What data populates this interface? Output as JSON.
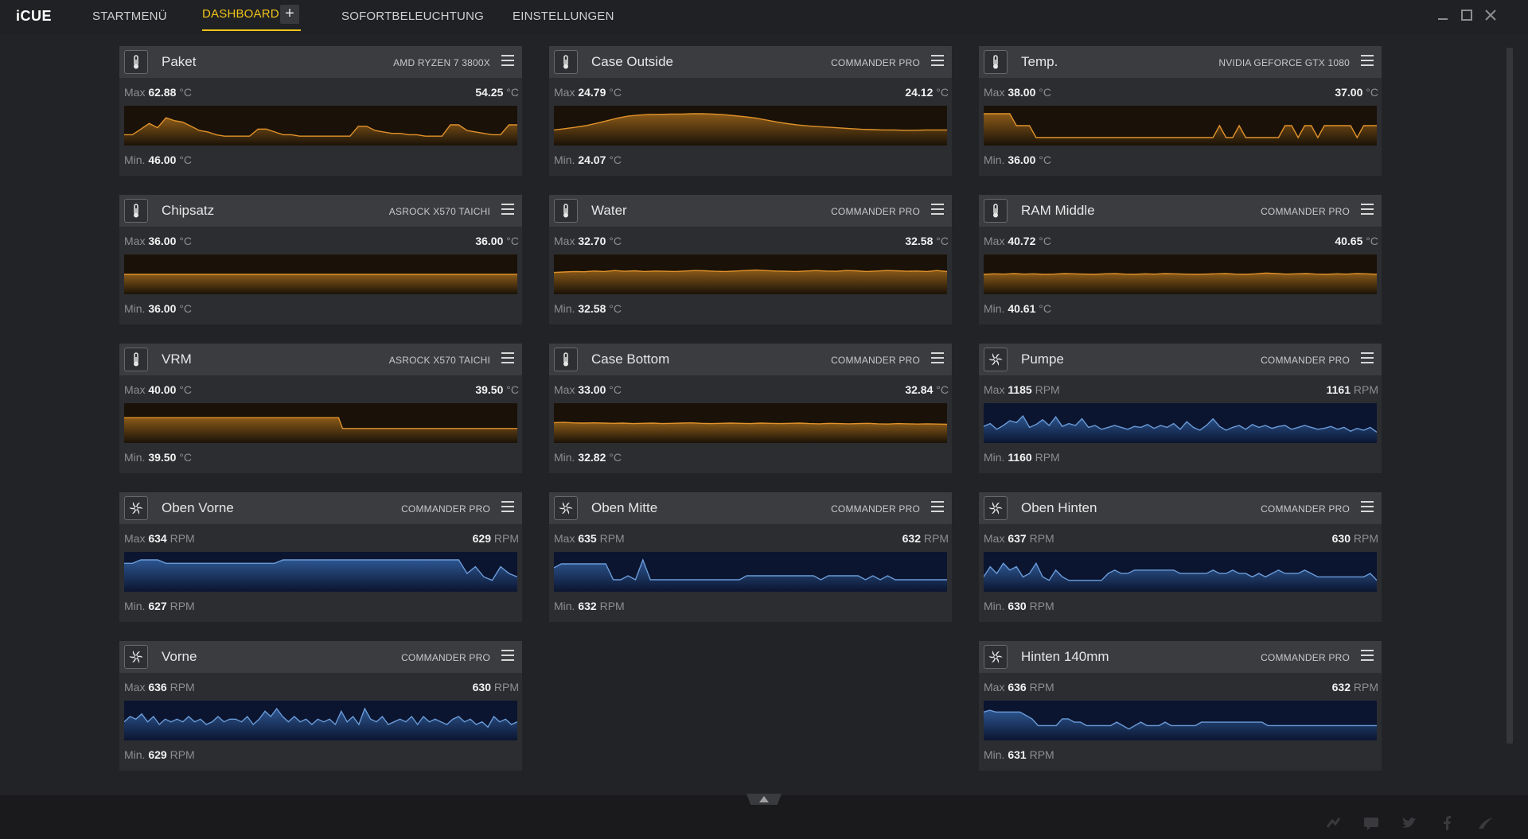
{
  "app": {
    "logo": "iCUE"
  },
  "nav": {
    "items": [
      {
        "label": "STARTMENÜ",
        "active": false
      },
      {
        "label": "DASHBOARD",
        "active": true
      },
      {
        "label": "SOFORTBELEUCHTUNG",
        "active": false
      },
      {
        "label": "EINSTELLUNGEN",
        "active": false
      }
    ],
    "add_label": "+"
  },
  "colors": {
    "accent": "#f0c419",
    "temp_line": "#e0912a",
    "temp_fill_top": "#8a5a18",
    "temp_fill_bottom": "#1a1208",
    "fan_line": "#6a9bd8",
    "fan_fill_top": "#2d5690",
    "fan_fill_bottom": "#0b1530"
  },
  "widgets": [
    {
      "id": "paket",
      "kind": "temp",
      "icon": "thermometer-icon",
      "title": "Paket",
      "device": "AMD RYZEN 7 3800X",
      "max_label": "Max",
      "max": "62.88",
      "current": "54.25",
      "min_label": "Min.",
      "min": "46.00",
      "unit": "°C",
      "range": [
        46.0,
        62.88
      ],
      "series": [
        48,
        48,
        52,
        56,
        53,
        60,
        58,
        57,
        54,
        51,
        50,
        48,
        47,
        47,
        47,
        47,
        52,
        52,
        50,
        48,
        48,
        47,
        47,
        47,
        47,
        47,
        47,
        47,
        54,
        54,
        51,
        50,
        49,
        49,
        48,
        48,
        47,
        47,
        47,
        55,
        55,
        51,
        50,
        49,
        48,
        48,
        55,
        55
      ]
    },
    {
      "id": "case-outside",
      "kind": "temp",
      "icon": "thermometer-icon",
      "title": "Case Outside",
      "device": "COMMANDER PRO",
      "max_label": "Max",
      "max": "24.79",
      "current": "24.12",
      "min_label": "Min.",
      "min": "24.07",
      "unit": "°C",
      "range": [
        24.07,
        24.79
      ],
      "series": [
        24.3,
        24.34,
        24.38,
        24.43,
        24.5,
        24.58,
        24.66,
        24.72,
        24.75,
        24.77,
        24.77,
        24.78,
        24.78,
        24.79,
        24.79,
        24.78,
        24.76,
        24.73,
        24.7,
        24.66,
        24.6,
        24.54,
        24.49,
        24.45,
        24.42,
        24.4,
        24.38,
        24.36,
        24.34,
        24.32,
        24.31,
        24.3,
        24.3,
        24.29,
        24.29,
        24.3,
        24.3,
        24.3
      ]
    },
    {
      "id": "temp-gpu",
      "kind": "temp",
      "icon": "thermometer-icon",
      "title": "Temp.",
      "device": "NVIDIA GEFORCE GTX 1080",
      "max_label": "Max",
      "max": "38.00",
      "current": "37.00",
      "min_label": "Min.",
      "min": "36.00",
      "unit": "°C",
      "range": [
        36.0,
        38.0
      ],
      "series": [
        38,
        38,
        38,
        38,
        38,
        37,
        37,
        37,
        36,
        36,
        36,
        36,
        36,
        36,
        36,
        36,
        36,
        36,
        36,
        36,
        36,
        36,
        36,
        36,
        36,
        36,
        36,
        36,
        36,
        36,
        36,
        36,
        36,
        36,
        36,
        36,
        37,
        36,
        36,
        37,
        36,
        36,
        36,
        36,
        36,
        36,
        37,
        37,
        36,
        37,
        37,
        36,
        37,
        37,
        37,
        37,
        37,
        36,
        37,
        37,
        37
      ]
    },
    {
      "id": "chipsatz",
      "kind": "temp",
      "icon": "thermometer-icon",
      "title": "Chipsatz",
      "device": "ASROCK X570 TAICHI",
      "max_label": "Max",
      "max": "36.00",
      "current": "36.00",
      "min_label": "Min.",
      "min": "36.00",
      "unit": "°C",
      "range": [
        35.0,
        37.0
      ],
      "series": [
        36,
        36,
        36,
        36,
        36,
        36,
        36,
        36,
        36,
        36
      ]
    },
    {
      "id": "water",
      "kind": "temp",
      "icon": "thermometer-icon",
      "title": "Water",
      "device": "COMMANDER PRO",
      "max_label": "Max",
      "max": "32.70",
      "current": "32.58",
      "min_label": "Min.",
      "min": "32.58",
      "unit": "°C",
      "range": [
        32.0,
        33.0
      ],
      "series": [
        32.58,
        32.6,
        32.62,
        32.61,
        32.64,
        32.62,
        32.66,
        32.63,
        32.65,
        32.62,
        32.64,
        32.63,
        32.62,
        32.64,
        32.66,
        32.65,
        32.63,
        32.62,
        32.64,
        32.66,
        32.68,
        32.66,
        32.64,
        32.63,
        32.62,
        32.64,
        32.66,
        32.64,
        32.63,
        32.66,
        32.65,
        32.62,
        32.64,
        32.66,
        32.65,
        32.63,
        32.64,
        32.62,
        32.66,
        32.62
      ]
    },
    {
      "id": "ram-middle",
      "kind": "temp",
      "icon": "thermometer-icon",
      "title": "RAM Middle",
      "device": "COMMANDER PRO",
      "max_label": "Max",
      "max": "40.72",
      "current": "40.65",
      "min_label": "Min.",
      "min": "40.61",
      "unit": "°C",
      "range": [
        40.2,
        41.1
      ],
      "series": [
        40.65,
        40.67,
        40.66,
        40.68,
        40.66,
        40.67,
        40.65,
        40.66,
        40.68,
        40.67,
        40.66,
        40.65,
        40.67,
        40.68,
        40.66,
        40.65,
        40.67,
        40.66,
        40.68,
        40.67,
        40.66,
        40.65,
        40.66,
        40.67,
        40.68,
        40.66,
        40.65,
        40.67,
        40.7,
        40.68,
        40.66,
        40.67,
        40.68,
        40.66,
        40.65,
        40.67,
        40.66,
        40.68,
        40.67,
        40.65
      ]
    },
    {
      "id": "vrm",
      "kind": "temp",
      "icon": "thermometer-icon",
      "title": "VRM",
      "device": "ASROCK X570 TAICHI",
      "max_label": "Max",
      "max": "40.00",
      "current": "39.50",
      "min_label": "Min.",
      "min": "39.50",
      "unit": "°C",
      "range": [
        39.2,
        40.3
      ],
      "series": [
        40,
        40,
        40,
        40,
        40,
        40,
        40,
        40,
        40,
        40,
        40,
        40,
        40,
        40,
        40,
        40,
        40,
        40,
        40,
        40,
        40,
        40,
        40,
        40,
        40,
        40,
        40,
        40,
        40,
        40,
        40,
        40,
        40,
        40,
        40,
        40,
        40,
        40,
        40,
        40,
        40,
        40,
        40,
        40,
        40,
        40,
        40,
        40,
        40,
        40,
        40,
        40,
        40,
        40,
        40,
        39.5,
        39.5,
        39.5,
        39.5,
        39.5,
        39.5,
        39.5,
        39.5,
        39.5,
        39.5,
        39.5,
        39.5,
        39.5,
        39.5,
        39.5,
        39.5,
        39.5,
        39.5,
        39.5,
        39.5,
        39.5,
        39.5,
        39.5,
        39.5,
        39.5,
        39.5,
        39.5,
        39.5,
        39.5,
        39.5,
        39.5,
        39.5,
        39.5,
        39.5,
        39.5,
        39.5,
        39.5,
        39.5,
        39.5,
        39.5,
        39.5,
        39.5,
        39.5,
        39.5,
        39.5
      ]
    },
    {
      "id": "case-bottom",
      "kind": "temp",
      "icon": "thermometer-icon",
      "title": "Case Bottom",
      "device": "COMMANDER PRO",
      "max_label": "Max",
      "max": "33.00",
      "current": "32.84",
      "min_label": "Min.",
      "min": "32.82",
      "unit": "°C",
      "range": [
        32.4,
        33.4
      ],
      "series": [
        32.92,
        32.93,
        32.91,
        32.9,
        32.91,
        32.9,
        32.89,
        32.9,
        32.88,
        32.89,
        32.9,
        32.88,
        32.89,
        32.9,
        32.91,
        32.89,
        32.88,
        32.89,
        32.9,
        32.89,
        32.88,
        32.9,
        32.89,
        32.88,
        32.89,
        32.9,
        32.88,
        32.87,
        32.89,
        32.88,
        32.87,
        32.88,
        32.89,
        32.87,
        32.86,
        32.88,
        32.87,
        32.86,
        32.87,
        32.86,
        32.85
      ]
    },
    {
      "id": "pumpe",
      "kind": "fan",
      "icon": "fan-icon",
      "title": "Pumpe",
      "device": "COMMANDER PRO",
      "max_label": "Max",
      "max": "1185",
      "current": "1161",
      "min_label": "Min.",
      "min": "1160",
      "unit": "RPM",
      "range": [
        1160,
        1185
      ],
      "series": [
        1169,
        1172,
        1166,
        1170,
        1175,
        1173,
        1180,
        1168,
        1171,
        1176,
        1170,
        1179,
        1169,
        1172,
        1170,
        1177,
        1168,
        1170,
        1166,
        1168,
        1170,
        1168,
        1166,
        1169,
        1168,
        1171,
        1167,
        1170,
        1168,
        1172,
        1166,
        1174,
        1168,
        1165,
        1170,
        1177,
        1169,
        1165,
        1168,
        1170,
        1166,
        1171,
        1168,
        1170,
        1167,
        1169,
        1170,
        1166,
        1168,
        1170,
        1168,
        1166,
        1167,
        1169,
        1166,
        1168,
        1164,
        1167,
        1165,
        1168,
        1163
      ]
    },
    {
      "id": "oben-vorne",
      "kind": "fan",
      "icon": "fan-icon",
      "title": "Oben Vorne",
      "device": "COMMANDER PRO",
      "max_label": "Max",
      "max": "634",
      "current": "629",
      "min_label": "Min.",
      "min": "627",
      "unit": "RPM",
      "range": [
        627,
        634
      ],
      "series": [
        633,
        633,
        634,
        634,
        634,
        633,
        633,
        633,
        633,
        633,
        633,
        633,
        633,
        633,
        633,
        633,
        633,
        633,
        633,
        634,
        634,
        634,
        634,
        634,
        634,
        634,
        634,
        634,
        634,
        634,
        634,
        634,
        634,
        634,
        634,
        634,
        634,
        634,
        634,
        634,
        634,
        630,
        632,
        629,
        628,
        632,
        630,
        629
      ]
    },
    {
      "id": "oben-mitte",
      "kind": "fan",
      "icon": "fan-icon",
      "title": "Oben Mitte",
      "device": "COMMANDER PRO",
      "max_label": "Max",
      "max": "635",
      "current": "632",
      "min_label": "Min.",
      "min": "632",
      "unit": "RPM",
      "range": [
        632,
        635
      ],
      "series": [
        634,
        634.5,
        634.5,
        634.5,
        634.5,
        634.5,
        634.5,
        634.5,
        632.5,
        632.5,
        633,
        632.5,
        635,
        632.5,
        632.5,
        632.5,
        632.5,
        632.5,
        632.5,
        632.5,
        632.5,
        632.5,
        632.5,
        632.5,
        632.5,
        632.5,
        633,
        633,
        633,
        633,
        633,
        633,
        633,
        633,
        633,
        633,
        632.5,
        633,
        633,
        633,
        633,
        633,
        632.5,
        633,
        632.5,
        633,
        632.5,
        632.5,
        632.5,
        632.5,
        632.5,
        632.5,
        632.5,
        632.5
      ]
    },
    {
      "id": "oben-hinten",
      "kind": "fan",
      "icon": "fan-icon",
      "title": "Oben Hinten",
      "device": "COMMANDER PRO",
      "max_label": "Max",
      "max": "637",
      "current": "630",
      "min_label": "Min.",
      "min": "630",
      "unit": "RPM",
      "range": [
        630,
        637
      ],
      "series": [
        632,
        635,
        633,
        636,
        634,
        635,
        632,
        633,
        636,
        632,
        631,
        634,
        632,
        631,
        631,
        631,
        631,
        631,
        631,
        633,
        634,
        633,
        633,
        634,
        634,
        634,
        634,
        634,
        634,
        634,
        633,
        633,
        633,
        633,
        633,
        634,
        633,
        633,
        634,
        633,
        633,
        632,
        633,
        632,
        633,
        634,
        633,
        633,
        633,
        634,
        633,
        632,
        632,
        632,
        632,
        632,
        632,
        632,
        632,
        633,
        631
      ]
    },
    {
      "id": "vorne",
      "kind": "fan",
      "icon": "fan-icon",
      "title": "Vorne",
      "device": "COMMANDER PRO",
      "max_label": "Max",
      "max": "636",
      "current": "630",
      "min_label": "Min.",
      "min": "629",
      "unit": "RPM",
      "range": [
        628,
        637
      ],
      "series": [
        632,
        634,
        633,
        635,
        632,
        634,
        631,
        633,
        632,
        633,
        632,
        634,
        632,
        633,
        631,
        632,
        634,
        632,
        633,
        633,
        632,
        634,
        631,
        633,
        636,
        634,
        637,
        634,
        632,
        634,
        632,
        633,
        631,
        633,
        632,
        633,
        631,
        636,
        632,
        634,
        631,
        637,
        633,
        632,
        634,
        631,
        632,
        633,
        632,
        634,
        631,
        634,
        632,
        633,
        632,
        631,
        633,
        634,
        632,
        633,
        631,
        632,
        630,
        634,
        632,
        633,
        631,
        632
      ]
    },
    {
      "id": "hinten-140mm",
      "kind": "fan",
      "icon": "fan-icon",
      "title": "Hinten 140mm",
      "device": "COMMANDER PRO",
      "max_label": "Max",
      "max": "636",
      "current": "632",
      "min_label": "Min.",
      "min": "631",
      "unit": "RPM",
      "range": [
        630,
        637
      ],
      "series": [
        636,
        636.5,
        636,
        636,
        636,
        636,
        636,
        635,
        634,
        632,
        632,
        632,
        632,
        634,
        634,
        633,
        633,
        632,
        632,
        632,
        632,
        632,
        633,
        632,
        631,
        632,
        633,
        632,
        632,
        632,
        633,
        632,
        632,
        632,
        632,
        632,
        633,
        633,
        633,
        633,
        633,
        633,
        633,
        633,
        633,
        633,
        633,
        632,
        632,
        632,
        632,
        632,
        632,
        632,
        632,
        632,
        632,
        632,
        632,
        632,
        632,
        632,
        632,
        632,
        632,
        632
      ]
    }
  ],
  "footer": {
    "social_icons": [
      "share-icon",
      "chat-icon",
      "twitter-icon",
      "facebook-icon",
      "corsair-icon"
    ]
  }
}
